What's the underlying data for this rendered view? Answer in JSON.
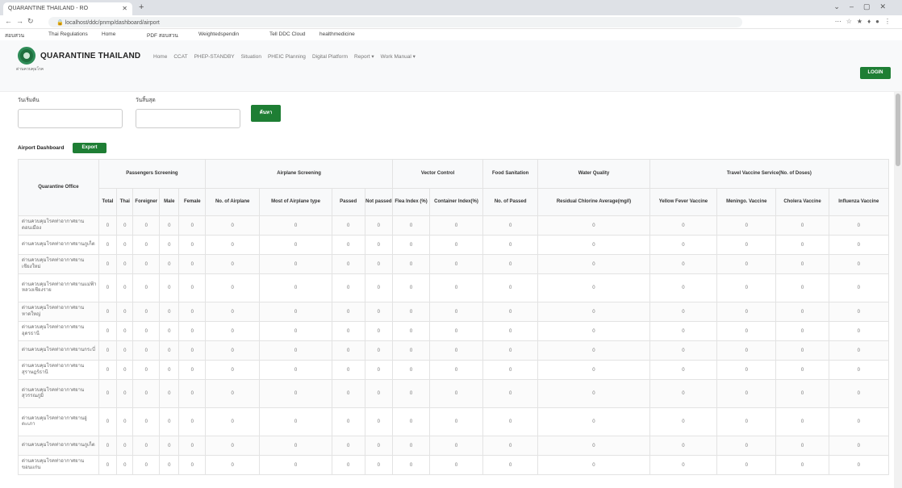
{
  "browser": {
    "tab_title": "QUARANTINE THAILAND - RO",
    "url": "localhost/ddc/pnmp/dashboard/airport"
  },
  "bookmarks": [
    "สอบสวน",
    "Thai Regulations",
    "Home",
    "PDF สอบสวน",
    "Weightedspendin",
    "Tell DDC Cloud",
    "healthmedicine"
  ],
  "navbar": {
    "brand": "QUARANTINE THAILAND",
    "logo_caption": "ด่านควบคุมโรค",
    "menu": [
      "Home",
      "CCAT",
      "PHEP-STANDBY",
      "Situation",
      "PHEIC Planning",
      "Digital Platform",
      "Report ▾",
      "Work Manual ▾"
    ],
    "login": "LOGIN"
  },
  "filters": {
    "start_label": "วันเริ่มต้น",
    "end_label": "วันสิ้นสุด",
    "search_button": "ค้นหา"
  },
  "dashboard": {
    "title": "Airport Dashboard",
    "export_button": "Export"
  },
  "table": {
    "office_header": "Quarantine Office",
    "groups": [
      "Passengers Screening",
      "Airplane Screening",
      "Vector Control",
      "Food Sanitation",
      "Water Quality",
      "Travel Vaccine Service(No. of Doses)"
    ],
    "columns": [
      "Total",
      "Thai",
      "Foreigner",
      "Male",
      "Female",
      "No. of Airplane",
      "Most of Airplane type",
      "Passed",
      "Not passed",
      "Flea Index (%)",
      "Container Index(%)",
      "No. of Passed",
      "Residual Chlorine Average(mg/l)",
      "Yellow Fever Vaccine",
      "Meningo. Vaccine",
      "Cholera Vaccine",
      "Influenza Vaccine"
    ],
    "rows": [
      {
        "office": "ด่านควบคุมโรคท่าอากาศยานดอนเมือง",
        "values": [
          "0",
          "0",
          "0",
          "0",
          "0",
          "0",
          "0",
          "0",
          "0",
          "0",
          "0",
          "0",
          "0",
          "0",
          "0",
          "0",
          "0"
        ]
      },
      {
        "office": "ด่านควบคุมโรคท่าอากาศยานภูเก็ต",
        "values": [
          "0",
          "0",
          "0",
          "0",
          "0",
          "0",
          "0",
          "0",
          "0",
          "0",
          "0",
          "0",
          "0",
          "0",
          "0",
          "0",
          "0"
        ]
      },
      {
        "office": "ด่านควบคุมโรคท่าอากาศยานเชียงใหม่",
        "values": [
          "0",
          "0",
          "0",
          "0",
          "0",
          "0",
          "0",
          "0",
          "0",
          "0",
          "0",
          "0",
          "0",
          "0",
          "0",
          "0",
          "0"
        ]
      },
      {
        "office": "ด่านควบคุมโรคท่าอากาศยานแม่ฟ้าหลวงเชียงราย",
        "values": [
          "0",
          "0",
          "0",
          "0",
          "0",
          "0",
          "0",
          "0",
          "0",
          "0",
          "0",
          "0",
          "0",
          "0",
          "0",
          "0",
          "0"
        ]
      },
      {
        "office": "ด่านควบคุมโรคท่าอากาศยานหาดใหญ่",
        "values": [
          "0",
          "0",
          "0",
          "0",
          "0",
          "0",
          "0",
          "0",
          "0",
          "0",
          "0",
          "0",
          "0",
          "0",
          "0",
          "0",
          "0"
        ]
      },
      {
        "office": "ด่านควบคุมโรคท่าอากาศยานอุดรธานี",
        "values": [
          "0",
          "0",
          "0",
          "0",
          "0",
          "0",
          "0",
          "0",
          "0",
          "0",
          "0",
          "0",
          "0",
          "0",
          "0",
          "0",
          "0"
        ]
      },
      {
        "office": "ด่านควบคุมโรคท่าอากาศยานกระบี่",
        "values": [
          "0",
          "0",
          "0",
          "0",
          "0",
          "0",
          "0",
          "0",
          "0",
          "0",
          "0",
          "0",
          "0",
          "0",
          "0",
          "0",
          "0"
        ]
      },
      {
        "office": "ด่านควบคุมโรคท่าอากาศยานสุราษฎร์ธานี",
        "values": [
          "0",
          "0",
          "0",
          "0",
          "0",
          "0",
          "0",
          "0",
          "0",
          "0",
          "0",
          "0",
          "0",
          "0",
          "0",
          "0",
          "0"
        ]
      },
      {
        "office": "ด่านควบคุมโรคท่าอากาศยานสุวรรณภูมิ",
        "values": [
          "0",
          "0",
          "0",
          "0",
          "0",
          "0",
          "0",
          "0",
          "0",
          "0",
          "0",
          "0",
          "0",
          "0",
          "0",
          "0",
          "0"
        ]
      },
      {
        "office": "ด่านควบคุมโรคท่าอากาศยานอู่ตะเภา",
        "values": [
          "0",
          "0",
          "0",
          "0",
          "0",
          "0",
          "0",
          "0",
          "0",
          "0",
          "0",
          "0",
          "0",
          "0",
          "0",
          "0",
          "0"
        ]
      },
      {
        "office": "ด่านควบคุมโรคท่าอากาศยานภูเก็ต",
        "values": [
          "0",
          "0",
          "0",
          "0",
          "0",
          "0",
          "0",
          "0",
          "0",
          "0",
          "0",
          "0",
          "0",
          "0",
          "0",
          "0",
          "0"
        ]
      },
      {
        "office": "ด่านควบคุมโรคท่าอากาศยานขอนแก่น",
        "values": [
          "0",
          "0",
          "0",
          "0",
          "0",
          "0",
          "0",
          "0",
          "0",
          "0",
          "0",
          "0",
          "0",
          "0",
          "0",
          "0",
          "0"
        ]
      }
    ]
  },
  "colors": {
    "primary_green": "#1e7e34",
    "navbar_bg": "#f8f9fa"
  }
}
